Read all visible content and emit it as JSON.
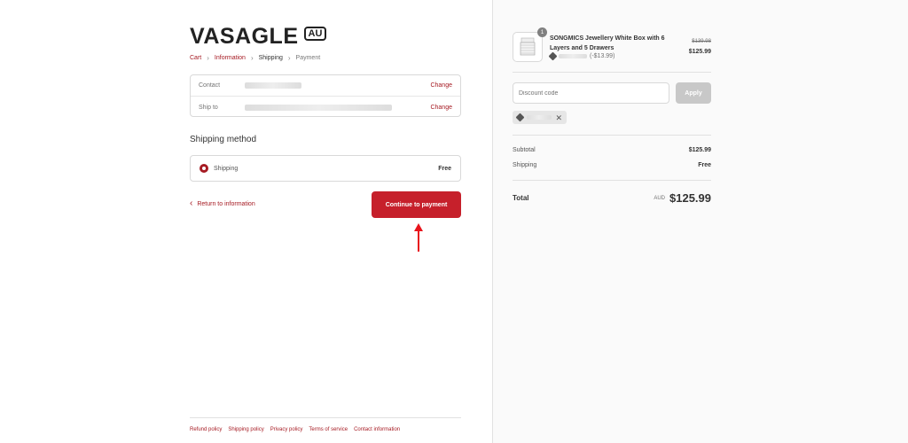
{
  "brand": {
    "name": "VASAGLE",
    "region": "AU"
  },
  "breadcrumb": {
    "cart": "Cart",
    "information": "Information",
    "shipping": "Shipping",
    "payment": "Payment"
  },
  "review": {
    "contact_label": "Contact",
    "contact_change": "Change",
    "shipto_label": "Ship to",
    "shipto_change": "Change"
  },
  "shipping_method": {
    "title": "Shipping method",
    "option_label": "Shipping",
    "option_price": "Free"
  },
  "actions": {
    "return_label": "Return to information",
    "continue_label": "Continue to payment"
  },
  "footer": {
    "links": [
      "Refund policy",
      "Shipping policy",
      "Privacy policy",
      "Terms of service",
      "Contact information"
    ]
  },
  "order": {
    "product": {
      "quantity": "1",
      "name": "SONGMICS Jewellery White Box with 6 Layers and 5 Drawers",
      "discount": "(-$13.99)",
      "original_price": "$139.98",
      "price": "$125.99"
    },
    "discount_code": {
      "placeholder": "Discount code",
      "apply_label": "Apply"
    },
    "subtotal_label": "Subtotal",
    "subtotal_value": "$125.99",
    "shipping_label": "Shipping",
    "shipping_value": "Free",
    "total_label": "Total",
    "total_currency": "AUD",
    "total_value": "$125.99"
  },
  "colors": {
    "accent": "#a61b23",
    "button": "#c6202b",
    "apply_disabled": "#c8c8c8"
  }
}
